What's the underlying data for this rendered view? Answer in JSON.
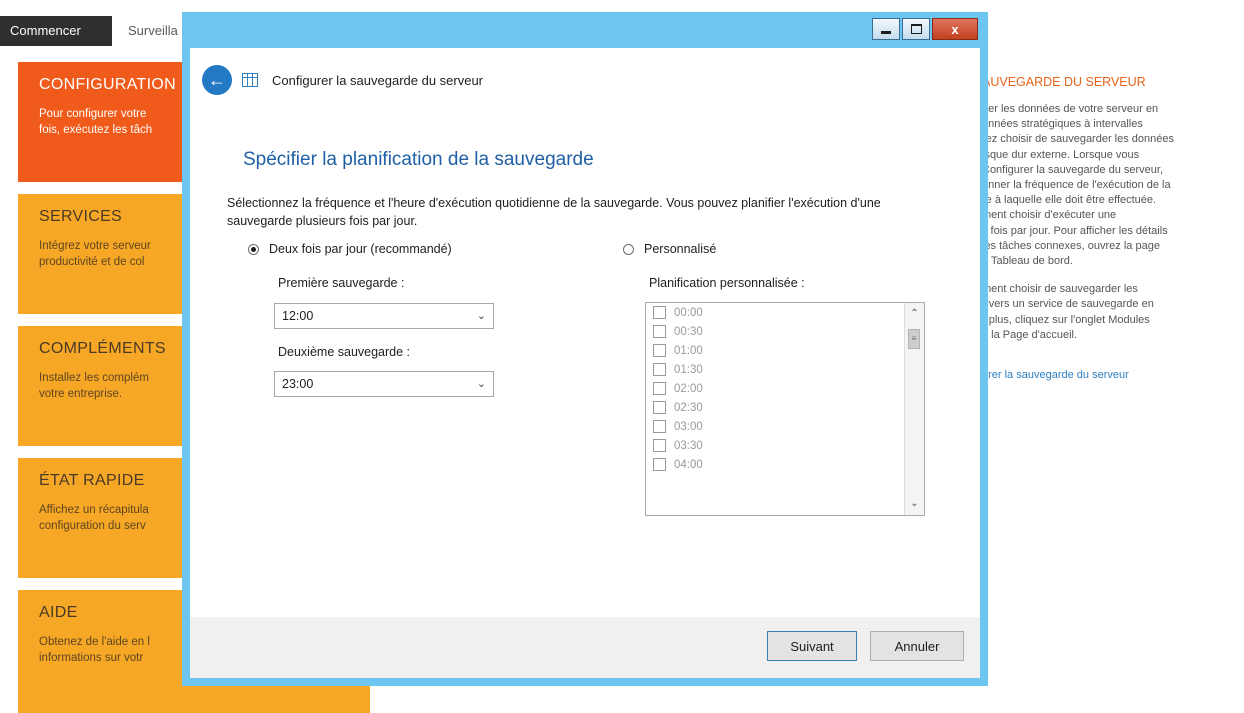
{
  "tabs": {
    "active": "Commencer",
    "second": "Surveilla"
  },
  "tiles": [
    {
      "title": "CONFIGURATION",
      "desc": "Pour configurer votre\nfois, exécutez les tâch"
    },
    {
      "title": "SERVICES",
      "desc": "Intégrez votre serveur\nproductivité et de col"
    },
    {
      "title": "COMPLÉMENTS",
      "desc": "Installez les complém\nvotre entreprise."
    },
    {
      "title": "ÉTAT RAPIDE",
      "desc": "Affichez un récapitula\nconfiguration du serv"
    },
    {
      "title": "AIDE",
      "desc": "Obtenez de l'aide en l\ninformations sur votr"
    }
  ],
  "info_panel": {
    "title": "AUVEGARDE DU SERVEUR",
    "p1": "ger les données de votre serveur en\nonnées stratégiques à intervalles\nrez choisir de sauvegarder les données\nisque dur externe. Lorsque vous\n Configurer la sauvegarde du serveur,\nonner la fréquence de l'exécution de la\nre à laquelle elle doit être effectuée.\nment choisir d'exécuter une\ns fois par jour. Pour afficher les détails\n les tâches connexes, ouvrez la page\ne Tableau de bord.",
    "p2": "ment choisir de sauvegarder les\nr vers un service de sauvegarde en\nr plus, cliquez sur l'onglet Modules\ne la Page d'accueil.",
    "link": "urer la sauvegarde du serveur"
  },
  "dialog": {
    "title": "Configurer la sauvegarde du serveur",
    "close_glyph": "x",
    "heading": "Spécifier la planification de la sauvegarde",
    "intro": "Sélectionnez la fréquence et l'heure d'exécution quotidienne de la sauvegarde. Vous pouvez planifier l'exécution d'une sauvegarde plusieurs fois par jour.",
    "option_twice": "Deux fois par jour (recommandé)",
    "option_custom": "Personnalisé",
    "first_label": "Première sauvegarde :",
    "first_value": "12:00",
    "second_label": "Deuxième sauvegarde :",
    "second_value": "23:00",
    "custom_label": "Planification personnalisée :",
    "custom_times": [
      "00:00",
      "00:30",
      "01:00",
      "01:30",
      "02:00",
      "02:30",
      "03:00",
      "03:30",
      "04:00"
    ],
    "next_button": "Suivant",
    "cancel_button": "Annuler"
  },
  "colors": {
    "tile_orange": "#f7a726",
    "tile_active": "#f05a1a",
    "dialog_frame": "#6cc6ef",
    "heading_blue": "#1f5fa6",
    "info_title": "#e8621a"
  }
}
